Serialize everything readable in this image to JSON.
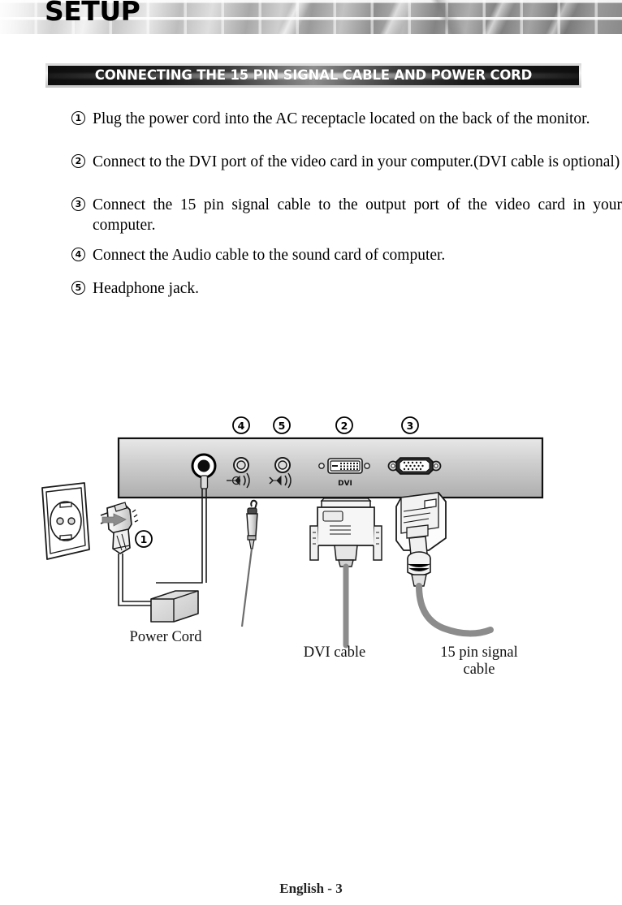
{
  "header": {
    "title": "SETUP"
  },
  "section": {
    "title": "CONNECTING THE 15 PIN SIGNAL CABLE AND POWER CORD"
  },
  "steps": [
    {
      "num": "1",
      "text": "Plug the power cord into the AC receptacle located on the back of the monitor."
    },
    {
      "num": "2",
      "text": "Connect to the DVI port of the video card in your computer.(DVI cable is optional)"
    },
    {
      "num": "3",
      "text": "Connect the 15 pin signal cable to the output port of the video card in your computer."
    },
    {
      "num": "4",
      "text": "Connect the Audio cable to the sound card of computer."
    },
    {
      "num": "5",
      "text": "Headphone jack."
    }
  ],
  "diagram": {
    "callouts": [
      {
        "num": "4",
        "target": "line-in-audio-jack"
      },
      {
        "num": "5",
        "target": "headphone-jack"
      },
      {
        "num": "2",
        "target": "dvi-port"
      },
      {
        "num": "3",
        "target": "vga-port"
      },
      {
        "num": "1",
        "target": "power-plug"
      }
    ],
    "port_labels": {
      "dvi": "DVI"
    },
    "cable_labels": {
      "power_cord": "Power  Cord",
      "dvi_cable": "DVI cable",
      "signal_cable_line1": "15 pin signal",
      "signal_cable_line2": "cable"
    },
    "colors": {
      "panel_top": "#e4e4e4",
      "panel_bottom": "#b2b2b2",
      "cable_gray": "#8c8c8c",
      "outline": "#1a1a1a",
      "connector_fill": "#ededed"
    }
  },
  "footer": {
    "page": "English - 3"
  }
}
